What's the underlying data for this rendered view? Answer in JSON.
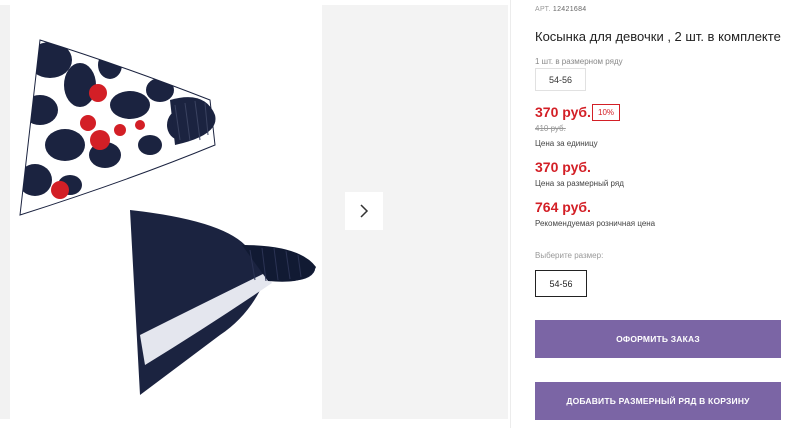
{
  "product": {
    "sku_label": "АРТ.",
    "sku": "12421684",
    "title": "Косынка для девочки , 2 шт. в комплекте",
    "image_alt": "Две косынки: с цветочным принтом и тёмно-синяя"
  },
  "series": {
    "label": "1 шт. в размерном ряду",
    "size": "54-56"
  },
  "prices": {
    "unit_price": "370 руб.",
    "discount": "10%",
    "old_price": "410 руб.",
    "unit_caption": "Цена за единицу",
    "series_price": "370 руб.",
    "series_caption": "Цена за размерный ряд",
    "retail_price": "764 руб.",
    "retail_caption": "Рекомендуемая розничная цена"
  },
  "size_select": {
    "label": "Выберите размер:",
    "selected": "54-56"
  },
  "actions": {
    "order": "ОФОРМИТЬ ЗАКАЗ",
    "add_to_cart": "ДОБАВИТЬ РАЗМЕРНЫЙ РЯД В КОРЗИНУ"
  },
  "gallery": {
    "next_icon": "chevron-right-icon"
  },
  "colors": {
    "price_red": "#d31f26",
    "button_purple": "#7b65a5",
    "navy": "#1b2340"
  }
}
